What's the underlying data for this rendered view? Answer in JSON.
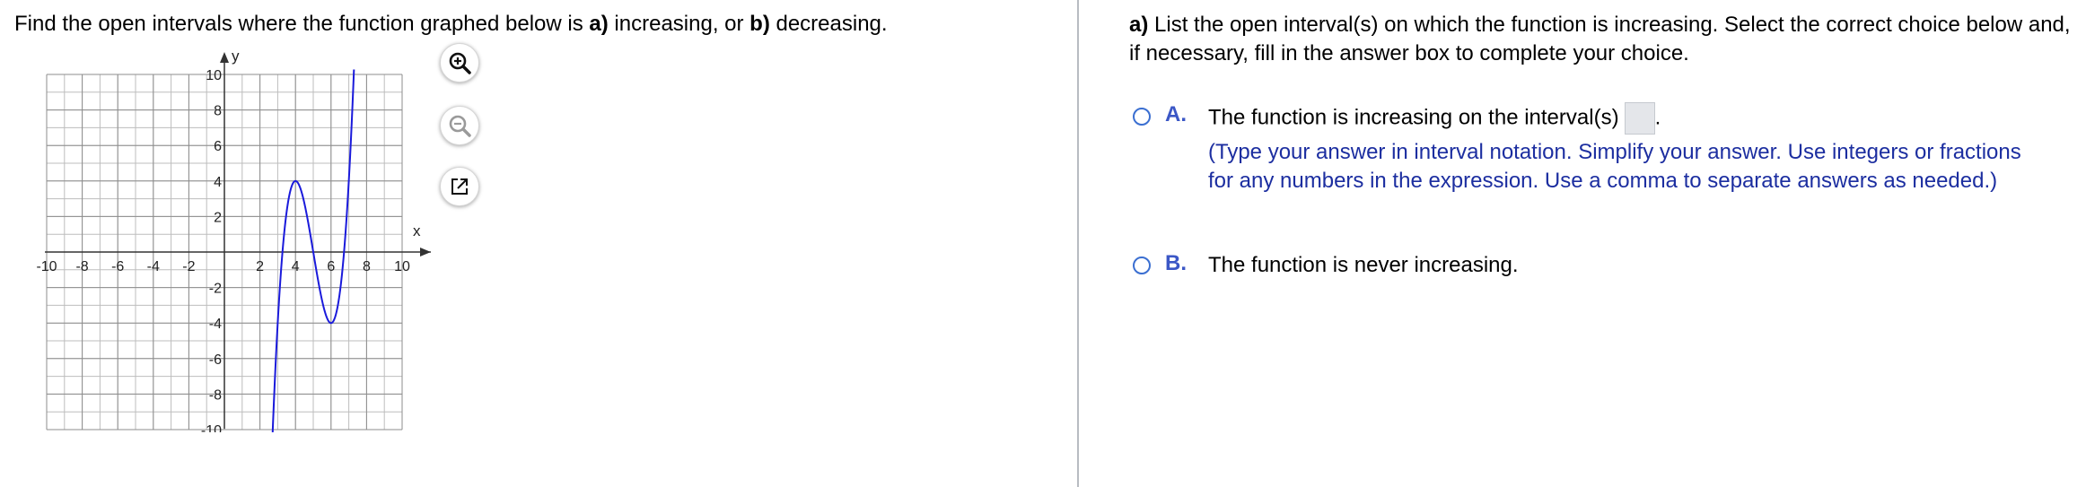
{
  "question": {
    "prefix": "Find the open intervals where the function graphed below is ",
    "part_a": "a)",
    "mid": " increasing, or ",
    "part_b": "b)",
    "suffix": " decreasing."
  },
  "graph": {
    "x_axis_label": "x",
    "y_axis_label": "y",
    "x_ticks": [
      "-10",
      "-8",
      "-6",
      "-4",
      "-2",
      "2",
      "4",
      "6",
      "8",
      "10"
    ],
    "y_ticks": [
      "10",
      "8",
      "6",
      "4",
      "2",
      "-2",
      "-4",
      "-6",
      "-8",
      "-10"
    ],
    "curve_color": "#1a1adb"
  },
  "tools": {
    "zoom_in": "zoom-in-icon",
    "zoom_out": "zoom-out-icon",
    "popout": "external-link-icon"
  },
  "panel": {
    "instruction_bold": "a)",
    "instruction": " List the open interval(s) on which the function is increasing. Select the correct choice below and, if necessary, fill in the answer box to complete your choice.",
    "choice_a": {
      "letter": "A.",
      "text": "The function is increasing on the interval(s)",
      "period": ".",
      "hint": "(Type your answer in interval notation. Simplify your answer. Use integers or fractions for any numbers in the expression. Use a comma to separate answers as needed.)"
    },
    "choice_b": {
      "letter": "B.",
      "text": "The function is never increasing."
    }
  },
  "colors": {
    "accent": "#3b57c6",
    "hint_text": "#1c2ea0",
    "radio_border": "#3b6fd1"
  }
}
